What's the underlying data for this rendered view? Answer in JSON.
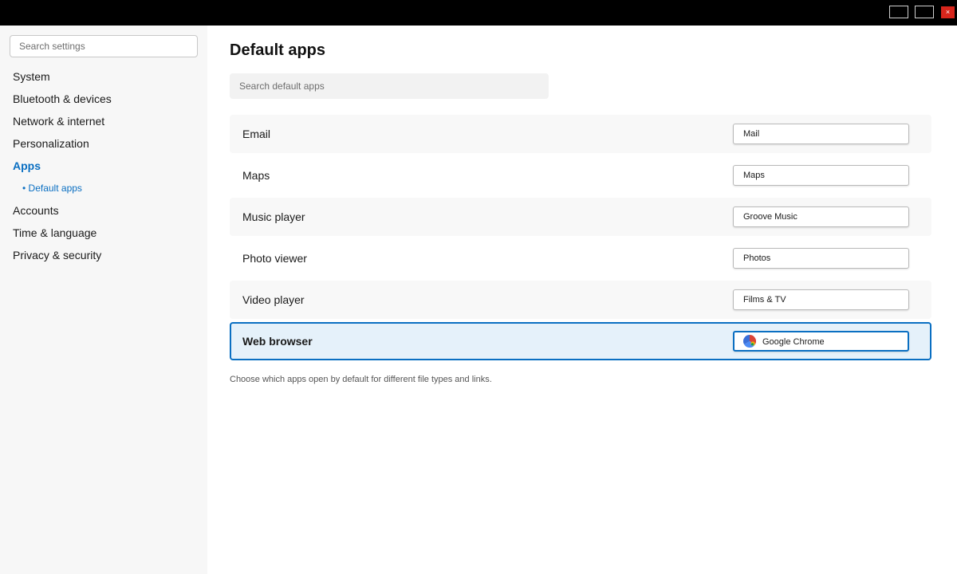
{
  "window": {
    "close_glyph": "×"
  },
  "sidebar": {
    "search_placeholder": "Search settings",
    "items": [
      {
        "label": "System"
      },
      {
        "label": "Bluetooth & devices"
      },
      {
        "label": "Network & internet"
      },
      {
        "label": "Personalization"
      },
      {
        "label": "Apps",
        "active": true
      },
      {
        "label": "• Default apps",
        "sub": true
      },
      {
        "label": "Accounts"
      },
      {
        "label": "Time & language"
      },
      {
        "label": "Privacy & security"
      }
    ]
  },
  "main": {
    "title": "Default apps",
    "search_placeholder": "Search default apps",
    "apps": [
      {
        "category": "Email",
        "app": "Mail"
      },
      {
        "category": "Maps",
        "app": "Maps"
      },
      {
        "category": "Music player",
        "app": "Groove Music"
      },
      {
        "category": "Photo viewer",
        "app": "Photos"
      },
      {
        "category": "Video player",
        "app": "Films & TV"
      },
      {
        "category": "Web browser",
        "app": "Google Chrome",
        "selected": true,
        "icon": "chrome-icon"
      }
    ],
    "help_text": "Choose which apps open by default for different file types and links."
  },
  "colors": {
    "accent": "#0a6fc2",
    "selected_row_bg": "#e5f1fa",
    "titlebar": "#000000",
    "close_button": "#d8261c",
    "sidebar_bg": "#f7f7f7"
  }
}
